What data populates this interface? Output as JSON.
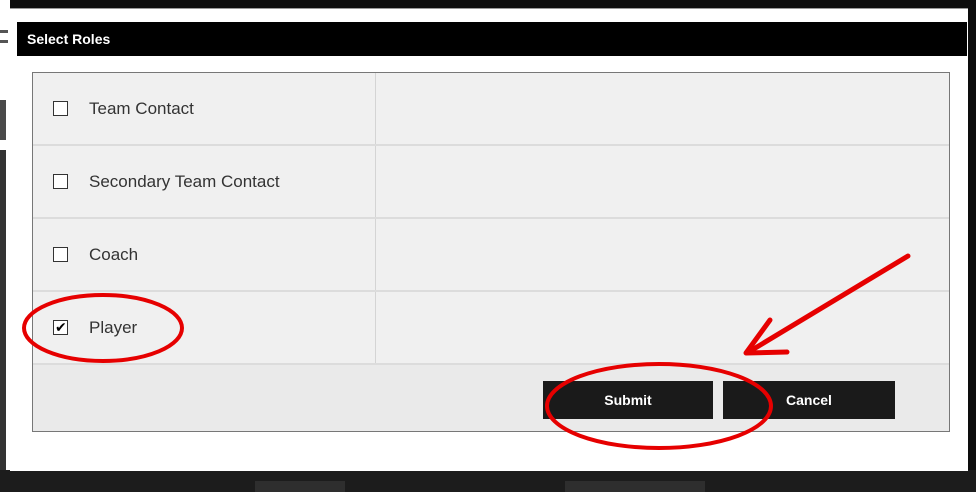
{
  "dialog": {
    "title": "Select Roles"
  },
  "roles": [
    {
      "label": "Team Contact",
      "checked": false
    },
    {
      "label": "Secondary Team Contact",
      "checked": false
    },
    {
      "label": "Coach",
      "checked": false
    },
    {
      "label": "Player",
      "checked": true
    }
  ],
  "checkmark_glyph": "✔",
  "buttons": {
    "submit_label": "Submit",
    "cancel_label": "Cancel"
  },
  "annotation": {
    "color": "#e60000",
    "shapes": [
      "ellipse-around-player",
      "ellipse-around-submit",
      "arrow-to-submit"
    ]
  }
}
